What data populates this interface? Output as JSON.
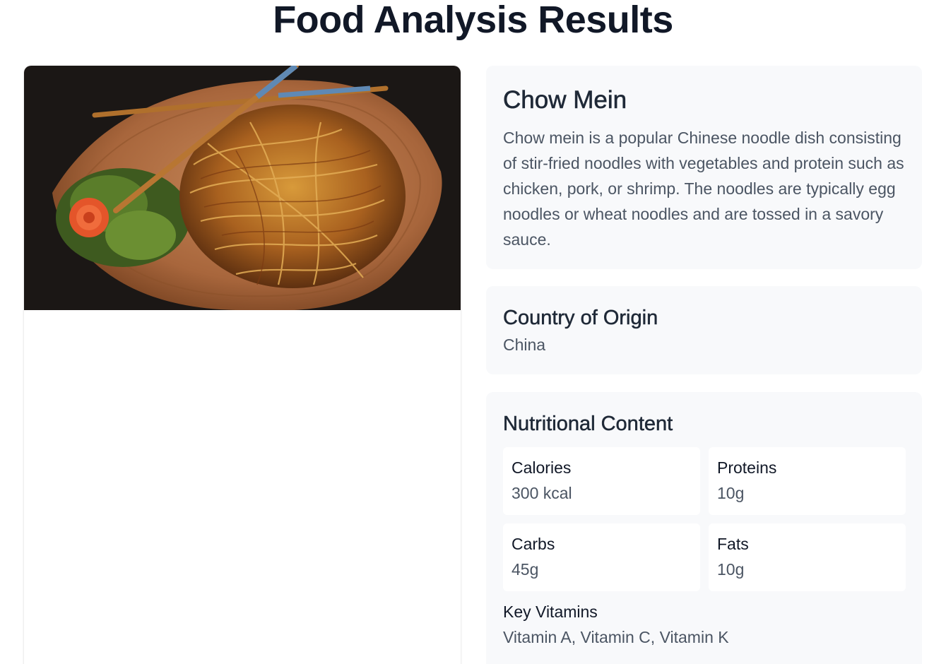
{
  "page": {
    "title": "Food Analysis Results"
  },
  "food": {
    "name": "Chow Mein",
    "description": "Chow mein is a popular Chinese noodle dish consisting of stir-fried noodles with vegetables and protein such as chicken, pork, or shrimp. The noodles are typically egg noodles or wheat noodles and are tossed in a savory sauce."
  },
  "origin": {
    "heading": "Country of Origin",
    "value": "China"
  },
  "nutrition": {
    "heading": "Nutritional Content",
    "items": [
      {
        "label": "Calories",
        "value": "300 kcal"
      },
      {
        "label": "Proteins",
        "value": "10g"
      },
      {
        "label": "Carbs",
        "value": "45g"
      },
      {
        "label": "Fats",
        "value": "10g"
      }
    ],
    "vitamins_label": "Key Vitamins",
    "vitamins_value": "Vitamin A, Vitamin C, Vitamin K"
  },
  "colors": {
    "card_background": "#f8f9fb",
    "title_text": "#111827",
    "body_text": "#4b5563"
  }
}
